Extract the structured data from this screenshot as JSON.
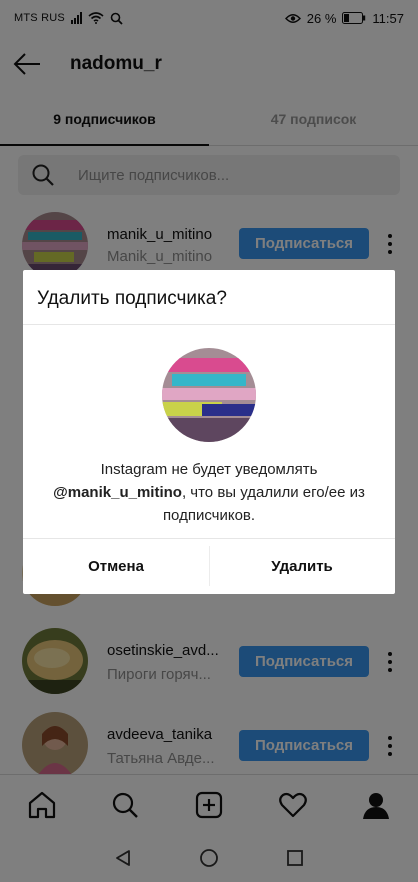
{
  "status_bar": {
    "carrier": "MTS RUS",
    "battery": "26 %",
    "time": "11:57"
  },
  "header": {
    "title": "nadomu_r"
  },
  "tabs": [
    {
      "label": "9 подписчиков",
      "active": true
    },
    {
      "label": "47 подписок",
      "active": false
    }
  ],
  "search": {
    "placeholder": "Ищите подписчиков..."
  },
  "followers": [
    {
      "username": "manik_u_mitino",
      "fullname": "Manik_u_mitino",
      "button": "Подписаться"
    },
    {
      "username": "osetinskie_avd...",
      "fullname": "Пироги горяч...",
      "button": "Подписаться"
    },
    {
      "username": "avdeeva_tanika",
      "fullname": "Татьяна Авде...",
      "button": "Подписаться"
    }
  ],
  "dialog": {
    "title": "Удалить подписчика?",
    "message_prefix": "Instagram не будет уведомлять",
    "message_user": "@manik_u_mitino",
    "message_suffix": ", что вы удалили его/ее из подписчиков.",
    "cancel": "Отмена",
    "delete": "Удалить"
  },
  "colors": {
    "accent": "#3897f0",
    "overlay": "rgba(0,0,0,0.5)"
  },
  "icons": {
    "bottom_nav": [
      "home-icon",
      "search-icon",
      "add-post-icon",
      "activity-heart-icon",
      "profile-icon"
    ],
    "system_nav": [
      "back-triangle-icon",
      "home-circle-icon",
      "recents-square-icon"
    ]
  }
}
